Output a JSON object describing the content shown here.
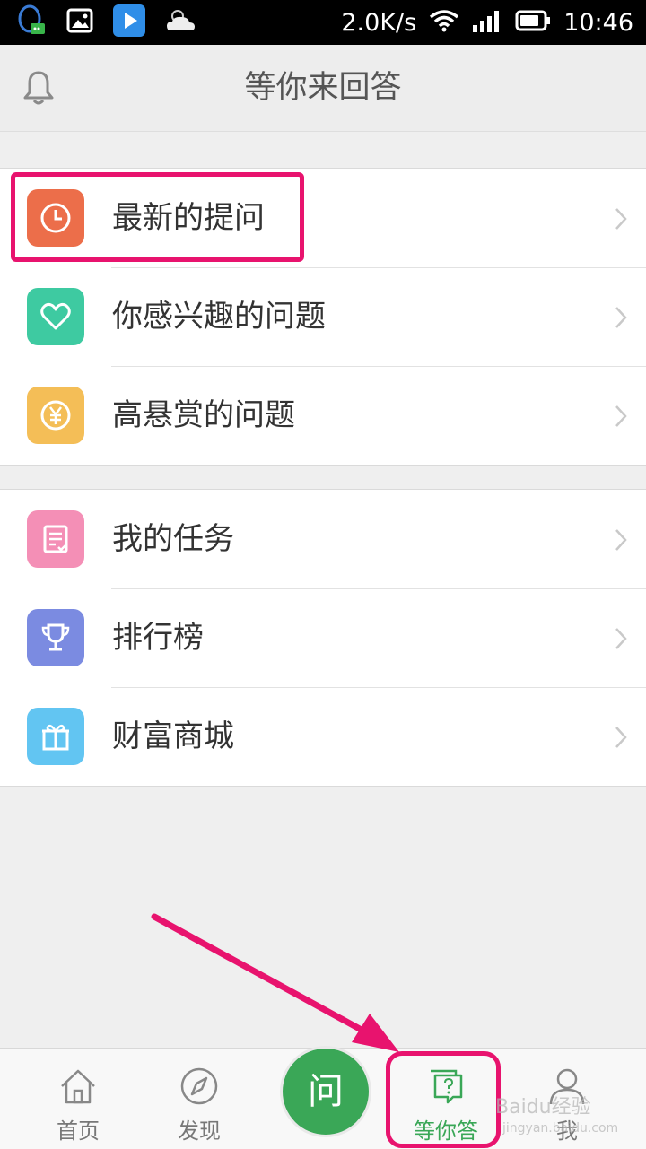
{
  "status_bar": {
    "net_speed": "2.0K/s",
    "time": "10:46",
    "icons": [
      "qq-icon",
      "gallery-icon",
      "video-play-icon",
      "weather-icon",
      "wifi-icon",
      "signal-icon",
      "battery-icon"
    ]
  },
  "header": {
    "title": "等你来回答",
    "left_icon": "bell-icon"
  },
  "groups": [
    {
      "items": [
        {
          "label": "最新的提问",
          "icon": "clock-icon",
          "color": "#ec6e4a"
        },
        {
          "label": "你感兴趣的问题",
          "icon": "heart-icon",
          "color": "#3ecaa1"
        },
        {
          "label": "高悬赏的问题",
          "icon": "yen-icon",
          "color": "#f4be57"
        }
      ]
    },
    {
      "items": [
        {
          "label": "我的任务",
          "icon": "task-list-icon",
          "color": "#f48fb6"
        },
        {
          "label": "排行榜",
          "icon": "trophy-icon",
          "color": "#7b8be1"
        },
        {
          "label": "财富商城",
          "icon": "gift-icon",
          "color": "#62c5f2"
        }
      ]
    }
  ],
  "tab_bar": {
    "tabs": [
      {
        "label": "首页",
        "icon": "home-icon"
      },
      {
        "label": "发现",
        "icon": "compass-icon"
      },
      {
        "label": "等你答",
        "icon": "question-bubble-icon",
        "active": true
      },
      {
        "label": "我",
        "icon": "person-icon"
      }
    ],
    "ask_button": "问"
  },
  "colors": {
    "accent_green": "#3aa757",
    "highlight_pink": "#e8136e"
  },
  "watermark": {
    "text": "Baidu经验",
    "sub": "jingyan.baidu.com"
  }
}
